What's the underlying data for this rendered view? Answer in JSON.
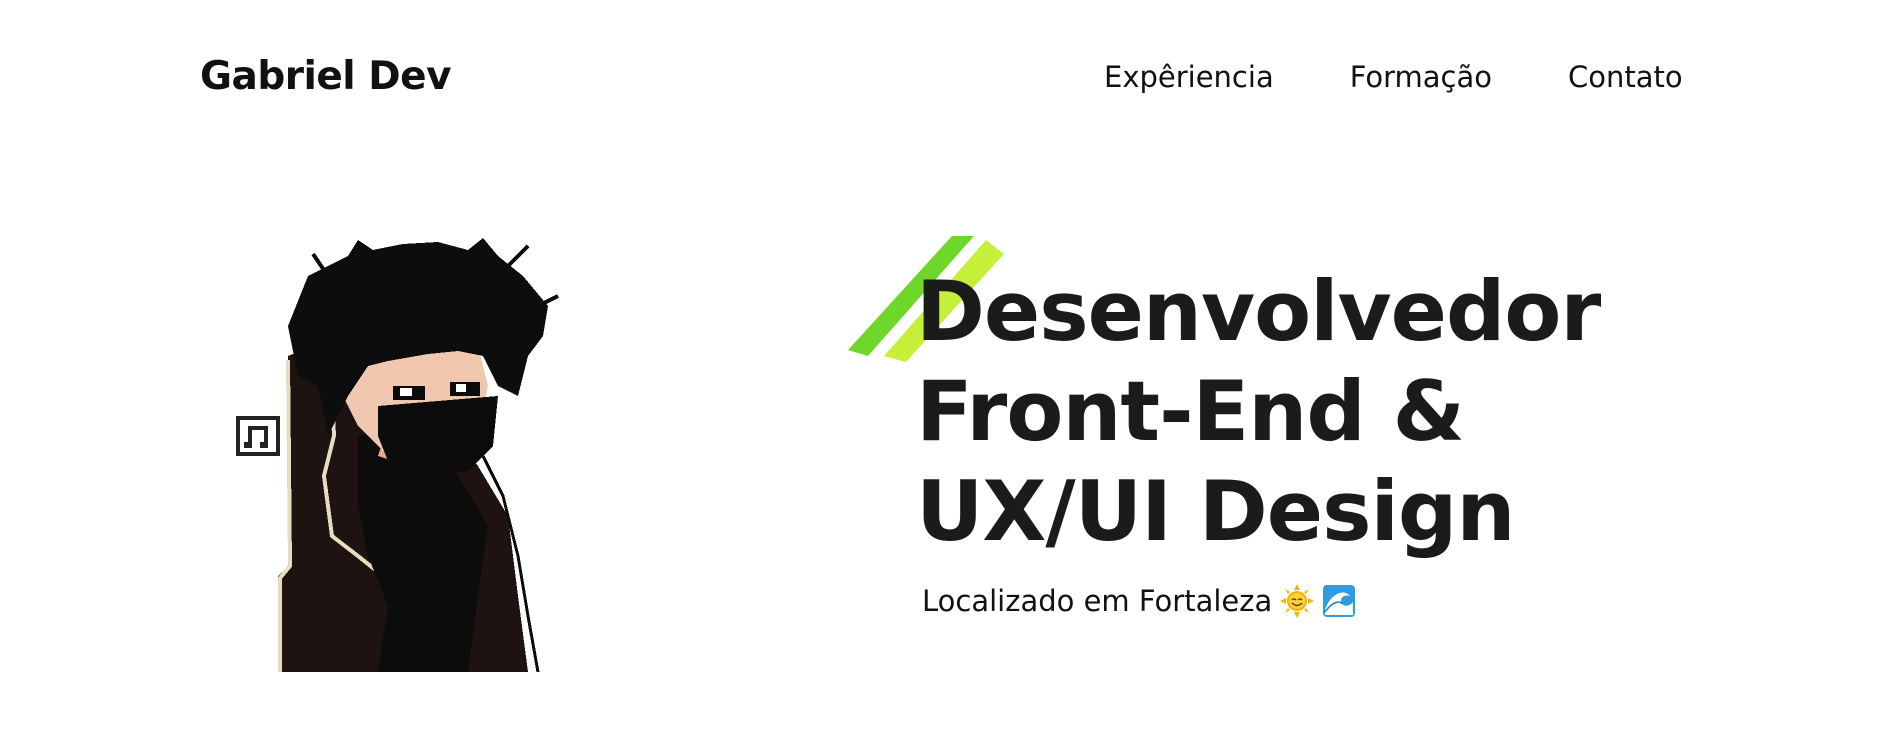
{
  "header": {
    "logo": "Gabriel Dev",
    "nav": [
      {
        "label": "Expêriencia"
      },
      {
        "label": "Formação"
      },
      {
        "label": "Contato"
      }
    ]
  },
  "hero": {
    "lines": [
      "Desenvolvedor",
      "Front-End &",
      "UX/UI Design"
    ],
    "location": "Localizado em Fortaleza",
    "location_icons": [
      "smiling-sun-icon",
      "wave-icon"
    ]
  },
  "colors": {
    "accent_dark": "#6fd62a",
    "accent_light": "#c6ef3a",
    "text": "#1b1b1b"
  },
  "avatar": {
    "icon": "pixel-art-avatar",
    "badge_icon": "music-note-icon"
  }
}
